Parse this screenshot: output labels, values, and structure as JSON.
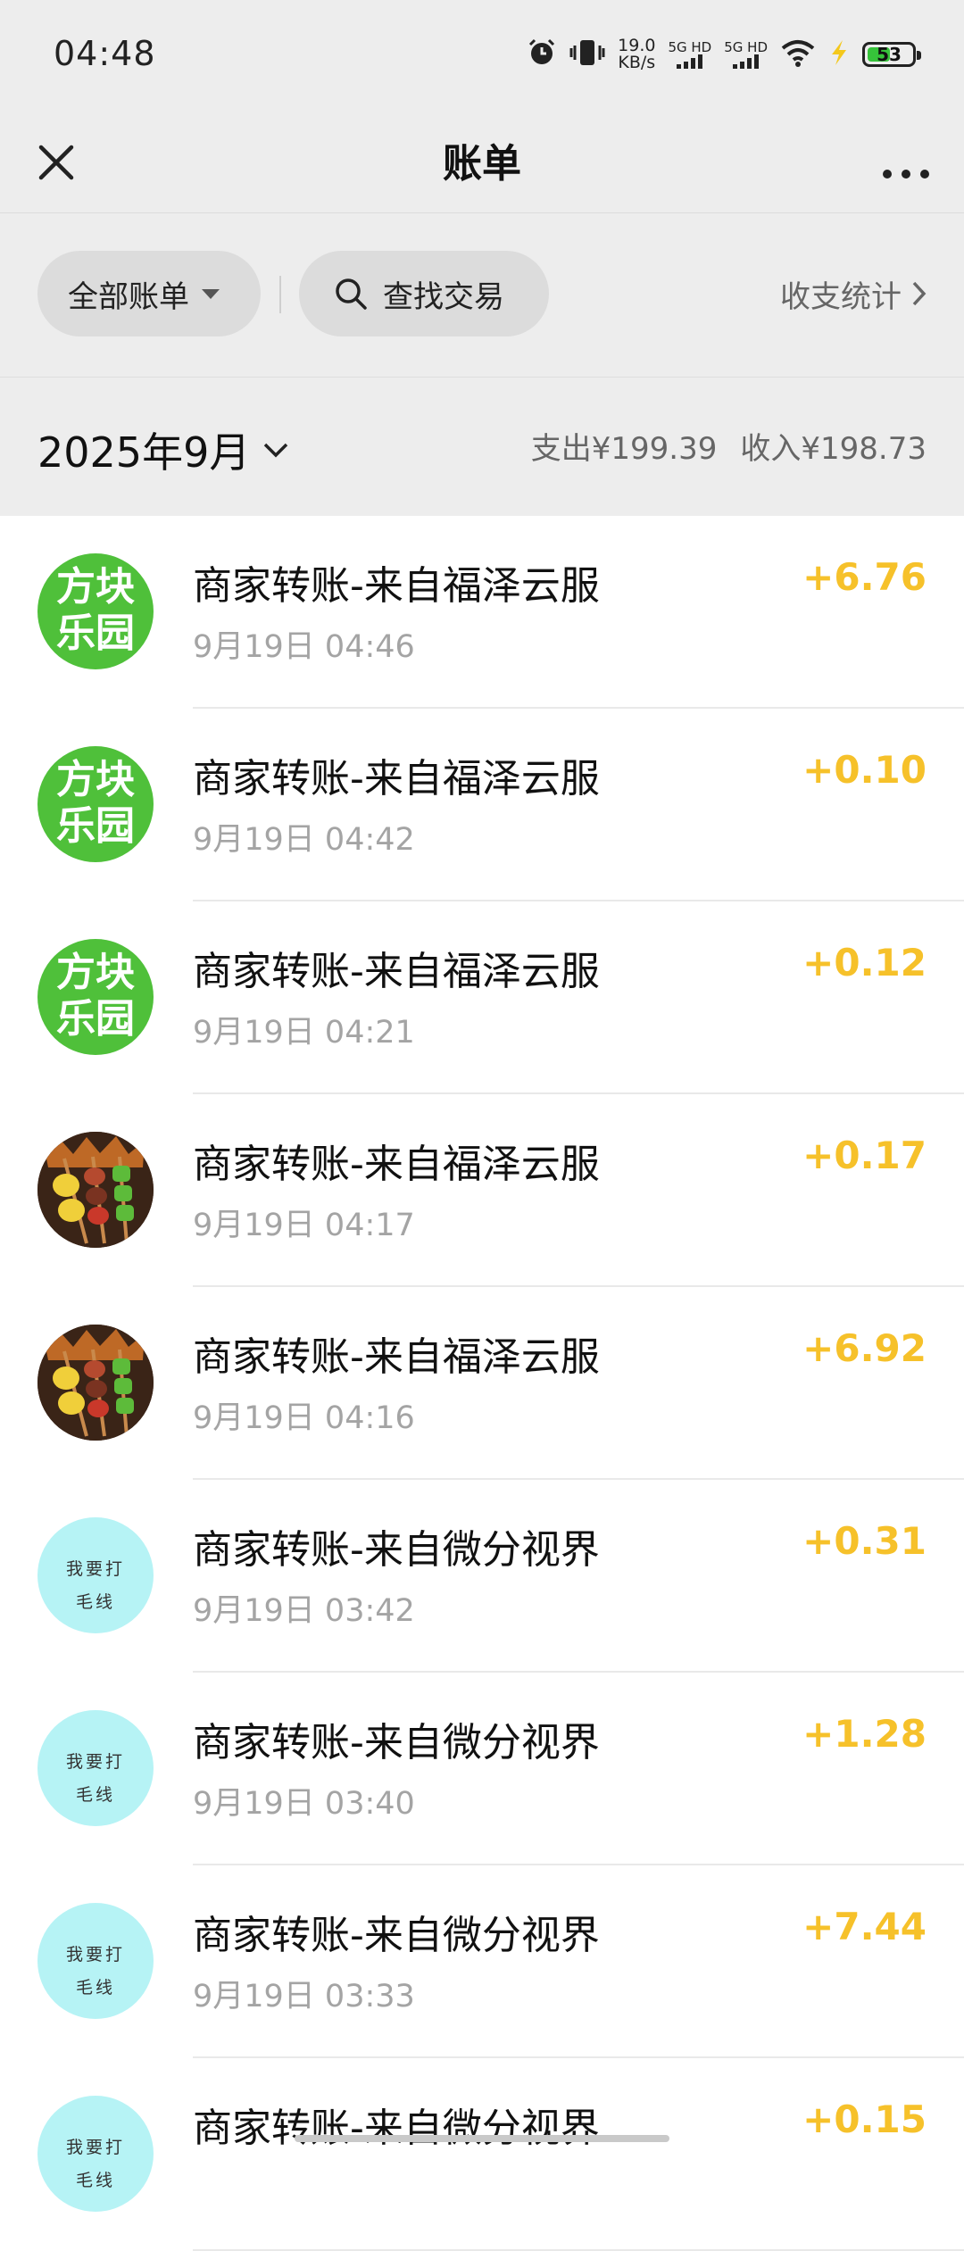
{
  "status_bar": {
    "time": "04:48",
    "net_speed_value": "19.0",
    "net_speed_unit": "KB/s",
    "sim1_label": "5G HD",
    "sim2_label": "5G HD",
    "battery": "53",
    "icons": [
      "alarm-icon",
      "vibrate-icon",
      "signal-icon",
      "wifi-icon",
      "charging-icon",
      "battery-icon"
    ]
  },
  "header": {
    "title": "账单",
    "close_icon": "close-icon",
    "more_icon": "more-icon"
  },
  "filters": {
    "all_bills": "全部账单",
    "search": "查找交易",
    "stats": "收支统计"
  },
  "month": {
    "label": "2025年9月",
    "expense": "支出¥199.39",
    "income": "收入¥198.73"
  },
  "colors": {
    "accent_income": "#f6c12a",
    "avatar_green": "#4fc03a",
    "avatar_cyan": "#b6f3f5",
    "background": "#ededed"
  },
  "transactions": [
    {
      "avatar": "fangkuai",
      "avatar_line1": "方块",
      "avatar_line2": "乐园",
      "title": "商家转账-来自福泽云服",
      "time": "9月19日 04:46",
      "amount": "+6.76"
    },
    {
      "avatar": "fangkuai",
      "avatar_line1": "方块",
      "avatar_line2": "乐园",
      "title": "商家转账-来自福泽云服",
      "time": "9月19日 04:42",
      "amount": "+0.10"
    },
    {
      "avatar": "fangkuai",
      "avatar_line1": "方块",
      "avatar_line2": "乐园",
      "title": "商家转账-来自福泽云服",
      "time": "9月19日 04:21",
      "amount": "+0.12"
    },
    {
      "avatar": "bbq",
      "title": "商家转账-来自福泽云服",
      "time": "9月19日 04:17",
      "amount": "+0.17"
    },
    {
      "avatar": "bbq",
      "title": "商家转账-来自福泽云服",
      "time": "9月19日 04:16",
      "amount": "+6.92"
    },
    {
      "avatar": "maoxian",
      "avatar_line1": "我要打",
      "avatar_line2": "毛线",
      "title": "商家转账-来自微分视界",
      "time": "9月19日 03:42",
      "amount": "+0.31"
    },
    {
      "avatar": "maoxian",
      "avatar_line1": "我要打",
      "avatar_line2": "毛线",
      "title": "商家转账-来自微分视界",
      "time": "9月19日 03:40",
      "amount": "+1.28"
    },
    {
      "avatar": "maoxian",
      "avatar_line1": "我要打",
      "avatar_line2": "毛线",
      "title": "商家转账-来自微分视界",
      "time": "9月19日 03:33",
      "amount": "+7.44"
    },
    {
      "avatar": "maoxian",
      "avatar_line1": "我要打",
      "avatar_line2": "毛线",
      "title": "商家转账-来自微分视界",
      "time": "",
      "amount": "+0.15"
    }
  ]
}
